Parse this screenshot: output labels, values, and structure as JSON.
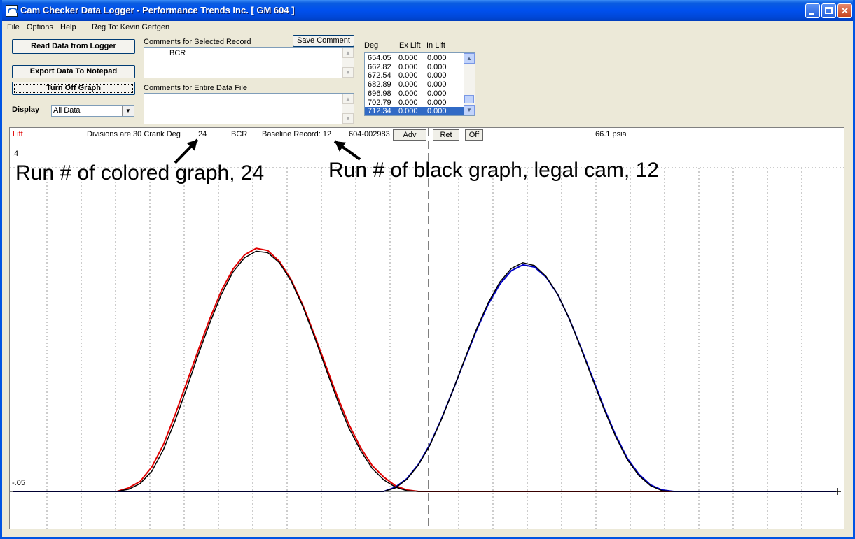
{
  "window": {
    "title": "Cam Checker Data Logger - Performance Trends Inc.   [ GM 604 ]",
    "controls": {
      "minimize": "_",
      "maximize": "□",
      "close": "✕"
    }
  },
  "menu": {
    "file": "File",
    "options": "Options",
    "help": "Help",
    "registration": "Reg To: Kevin Gertgen"
  },
  "buttons": {
    "read": "Read Data from Logger",
    "export": "Export Data To Notepad",
    "graph_toggle": "Turn Off Graph",
    "save_comment": "Save Comment"
  },
  "display": {
    "label": "Display",
    "selected": "All Data"
  },
  "comments": {
    "selected_label": "Comments for Selected Record",
    "selected_value": "BCR",
    "file_label": "Comments for Entire Data File",
    "file_value": ""
  },
  "table": {
    "headers": [
      "Deg",
      "Ex Lift",
      "In Lift"
    ],
    "rows": [
      [
        "654.05",
        "0.000",
        "0.000"
      ],
      [
        "662.82",
        "0.000",
        "0.000"
      ],
      [
        "672.54",
        "0.000",
        "0.000"
      ],
      [
        "682.89",
        "0.000",
        "0.000"
      ],
      [
        "696.98",
        "0.000",
        "0.000"
      ],
      [
        "702.79",
        "0.000",
        "0.000"
      ],
      [
        "712.34",
        "0.000",
        "0.000"
      ]
    ],
    "selected_index": 6
  },
  "graph": {
    "lift_label": "Lift",
    "divisions": "Divisions are 30 Crank Deg",
    "run_number": "24",
    "comment": "BCR",
    "baseline": "Baseline Record: 12",
    "serial": "604-002983",
    "adv_button": "Adv",
    "ret_button": "Ret",
    "off_button": "Off",
    "pressure": "66.1 psia",
    "y_top": ".4",
    "y_bottom": "-.05"
  },
  "annotations": {
    "colored": "Run # of colored graph, 24",
    "black": "Run # of black graph, legal cam, 12"
  },
  "chart_data": {
    "type": "line",
    "xlabel": "",
    "ylabel": "Lift",
    "ylim": [
      -0.05,
      0.4
    ],
    "x": [
      0,
      10,
      20,
      30,
      40,
      50,
      60,
      70,
      80,
      90,
      100,
      110,
      120,
      130,
      140,
      150,
      160,
      170,
      180,
      190,
      200,
      210,
      220,
      230,
      240,
      250,
      260,
      270,
      280,
      290,
      300,
      310,
      320,
      330,
      340,
      350,
      360,
      370,
      380,
      390,
      400,
      410,
      420,
      430,
      440,
      450,
      460,
      470,
      480,
      490,
      500,
      510,
      520,
      530,
      540,
      550,
      560,
      570,
      580,
      590,
      600,
      610,
      620,
      630,
      640,
      650,
      660,
      670,
      680,
      690,
      700,
      710
    ],
    "series": [
      {
        "color": "#e00000",
        "values": [
          -0.05,
          -0.05,
          -0.05,
          -0.05,
          -0.05,
          -0.05,
          -0.05,
          -0.05,
          -0.05,
          -0.05,
          -0.045,
          -0.036,
          -0.016,
          0.015,
          0.056,
          0.101,
          0.146,
          0.19,
          0.229,
          0.259,
          0.279,
          0.288,
          0.285,
          0.27,
          0.245,
          0.21,
          0.169,
          0.125,
          0.082,
          0.043,
          0.011,
          -0.014,
          -0.03,
          -0.042,
          -0.048,
          -0.05,
          -0.05,
          -0.05,
          -0.05,
          -0.05,
          -0.05,
          -0.05,
          -0.05,
          -0.05,
          -0.05,
          -0.05,
          -0.05,
          -0.05,
          -0.05,
          -0.05,
          -0.05,
          -0.05,
          -0.05,
          -0.05,
          -0.05,
          -0.05,
          -0.05,
          -0.05,
          -0.05,
          -0.05,
          -0.05,
          -0.05,
          -0.05,
          -0.05,
          -0.05,
          -0.05,
          -0.05,
          -0.05,
          -0.05,
          -0.05,
          -0.05,
          -0.05
        ]
      },
      {
        "color": "#000000",
        "values": [
          -0.05,
          -0.05,
          -0.05,
          -0.05,
          -0.05,
          -0.05,
          -0.05,
          -0.05,
          -0.05,
          -0.05,
          -0.047,
          -0.039,
          -0.022,
          0.008,
          0.048,
          0.093,
          0.14,
          0.184,
          0.224,
          0.255,
          0.275,
          0.284,
          0.282,
          0.268,
          0.243,
          0.208,
          0.166,
          0.121,
          0.077,
          0.038,
          0.007,
          -0.018,
          -0.034,
          -0.044,
          -0.049,
          -0.05,
          -0.05,
          -0.05,
          -0.05,
          -0.05,
          -0.05,
          -0.05,
          -0.05,
          -0.05,
          -0.05,
          -0.05,
          -0.05,
          -0.05,
          -0.05,
          -0.05,
          -0.05,
          -0.05,
          -0.05,
          -0.05,
          -0.05,
          -0.05,
          -0.05,
          -0.05,
          -0.05,
          -0.05,
          -0.05,
          -0.05,
          -0.05,
          -0.05,
          -0.05,
          -0.05,
          -0.05,
          -0.05,
          -0.05,
          -0.05,
          -0.05,
          -0.05
        ]
      },
      {
        "color": "#0000c8",
        "values": [
          -0.05,
          -0.05,
          -0.05,
          -0.05,
          -0.05,
          -0.05,
          -0.05,
          -0.05,
          -0.05,
          -0.05,
          -0.05,
          -0.05,
          -0.05,
          -0.05,
          -0.05,
          -0.05,
          -0.05,
          -0.05,
          -0.05,
          -0.05,
          -0.05,
          -0.05,
          -0.05,
          -0.05,
          -0.05,
          -0.05,
          -0.05,
          -0.05,
          -0.05,
          -0.05,
          -0.05,
          -0.05,
          -0.05,
          -0.044,
          -0.032,
          -0.012,
          0.016,
          0.052,
          0.092,
          0.134,
          0.174,
          0.21,
          0.238,
          0.257,
          0.265,
          0.262,
          0.248,
          0.224,
          0.19,
          0.15,
          0.108,
          0.066,
          0.028,
          -0.004,
          -0.026,
          -0.041,
          -0.048,
          -0.05,
          -0.05,
          -0.05,
          -0.05,
          -0.05,
          -0.05,
          -0.05,
          -0.05,
          -0.05,
          -0.05,
          -0.05,
          -0.05,
          -0.05,
          -0.05,
          -0.05
        ]
      },
      {
        "color": "#000000",
        "values": [
          -0.05,
          -0.05,
          -0.05,
          -0.05,
          -0.05,
          -0.05,
          -0.05,
          -0.05,
          -0.05,
          -0.05,
          -0.05,
          -0.05,
          -0.05,
          -0.05,
          -0.05,
          -0.05,
          -0.05,
          -0.05,
          -0.05,
          -0.05,
          -0.05,
          -0.05,
          -0.05,
          -0.05,
          -0.05,
          -0.05,
          -0.05,
          -0.05,
          -0.05,
          -0.05,
          -0.05,
          -0.05,
          -0.05,
          -0.045,
          -0.033,
          -0.013,
          0.015,
          0.051,
          0.092,
          0.135,
          0.176,
          0.212,
          0.241,
          0.26,
          0.268,
          0.264,
          0.249,
          0.224,
          0.19,
          0.149,
          0.106,
          0.064,
          0.026,
          -0.006,
          -0.028,
          -0.042,
          -0.049,
          -0.05,
          -0.05,
          -0.05,
          -0.05,
          -0.05,
          -0.05,
          -0.05,
          -0.05,
          -0.05,
          -0.05,
          -0.05,
          -0.05,
          -0.05,
          -0.05,
          -0.05
        ]
      }
    ]
  }
}
